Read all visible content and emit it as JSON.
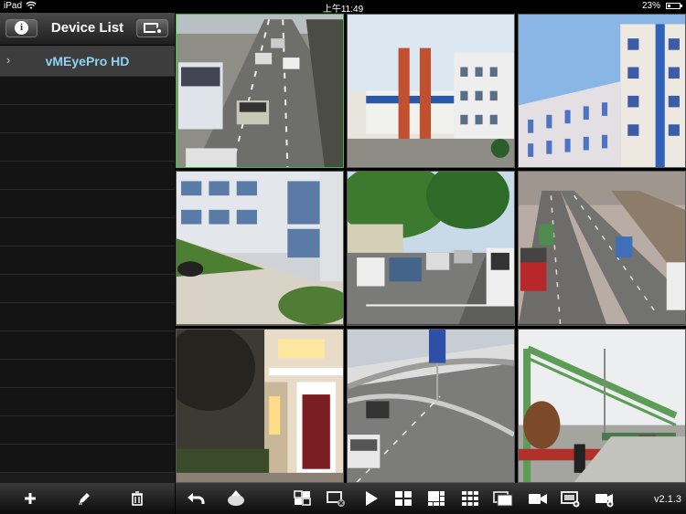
{
  "status_bar": {
    "carrier": "iPad",
    "time": "上午11:49",
    "battery": "23%",
    "battery_level": 0.23
  },
  "sidebar": {
    "title": "Device List",
    "devices": [
      {
        "name": "vMEyePro HD",
        "selected": true
      }
    ],
    "empty_rows": 14
  },
  "toolbar": {
    "left_icons": [
      "add-icon",
      "edit-pencil-icon",
      "delete-trash-icon"
    ],
    "right_icons": [
      "back-arrow-icon",
      "ptz-control-icon",
      "layout-switch-icon",
      "stop-all-icon",
      "play-icon",
      "grid-2x2-icon",
      "grid-3x3-layout-icon",
      "grid-3x3-icon",
      "fullscreen-icon",
      "record-camera-icon",
      "snapshot-monitor-icon",
      "video-playback-icon"
    ],
    "version": "v2.1.3"
  },
  "video_grid": {
    "rows": 3,
    "cols": 3,
    "active_index": 0,
    "active_color": "#2fc22f",
    "channels": [
      {
        "scene": "highway-traffic"
      },
      {
        "scene": "building-pillars"
      },
      {
        "scene": "apartment-blue"
      },
      {
        "scene": "office-lawn"
      },
      {
        "scene": "street-trees-cars"
      },
      {
        "scene": "highway-trucks"
      },
      {
        "scene": "house-doorway"
      },
      {
        "scene": "overpass-sign"
      },
      {
        "scene": "gantry-road"
      }
    ]
  }
}
